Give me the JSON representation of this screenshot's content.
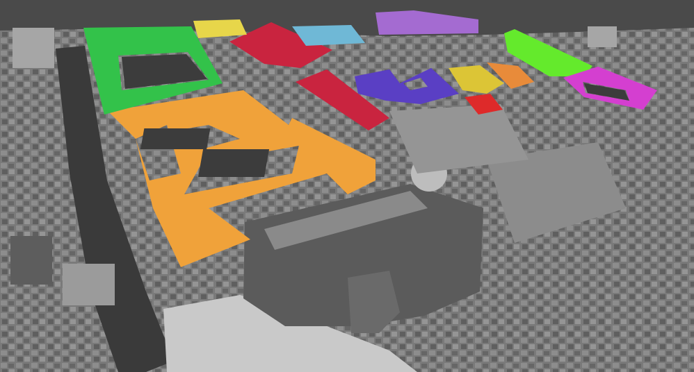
{
  "scene": {
    "kind": "aerial photograph",
    "colors": {
      "water": "#4a4a4a",
      "ground": "#7a7a7a",
      "roof_dark": "#5b5b5b",
      "roof_light": "#9a9a9a",
      "courtyard": "#3c3c3c",
      "piazza": "#c9c9c9",
      "canal": "#3a3a3a"
    }
  },
  "highlights": [
    {
      "id": "orange",
      "color": "#f0a23a"
    },
    {
      "id": "green",
      "color": "#33c24a"
    },
    {
      "id": "red",
      "color": "#c9243f"
    },
    {
      "id": "purple-top",
      "color": "#a46bd1"
    },
    {
      "id": "blue-purple",
      "color": "#5a3fc4"
    },
    {
      "id": "cyan",
      "color": "#6fb8d6"
    },
    {
      "id": "yellow",
      "color": "#e7d64a"
    },
    {
      "id": "lime",
      "color": "#64ea2c"
    },
    {
      "id": "magenta",
      "color": "#d43fd0"
    },
    {
      "id": "mustard",
      "color": "#dcc536"
    },
    {
      "id": "orange-small",
      "color": "#e88b3a"
    },
    {
      "id": "red-small",
      "color": "#de2a2a"
    }
  ]
}
